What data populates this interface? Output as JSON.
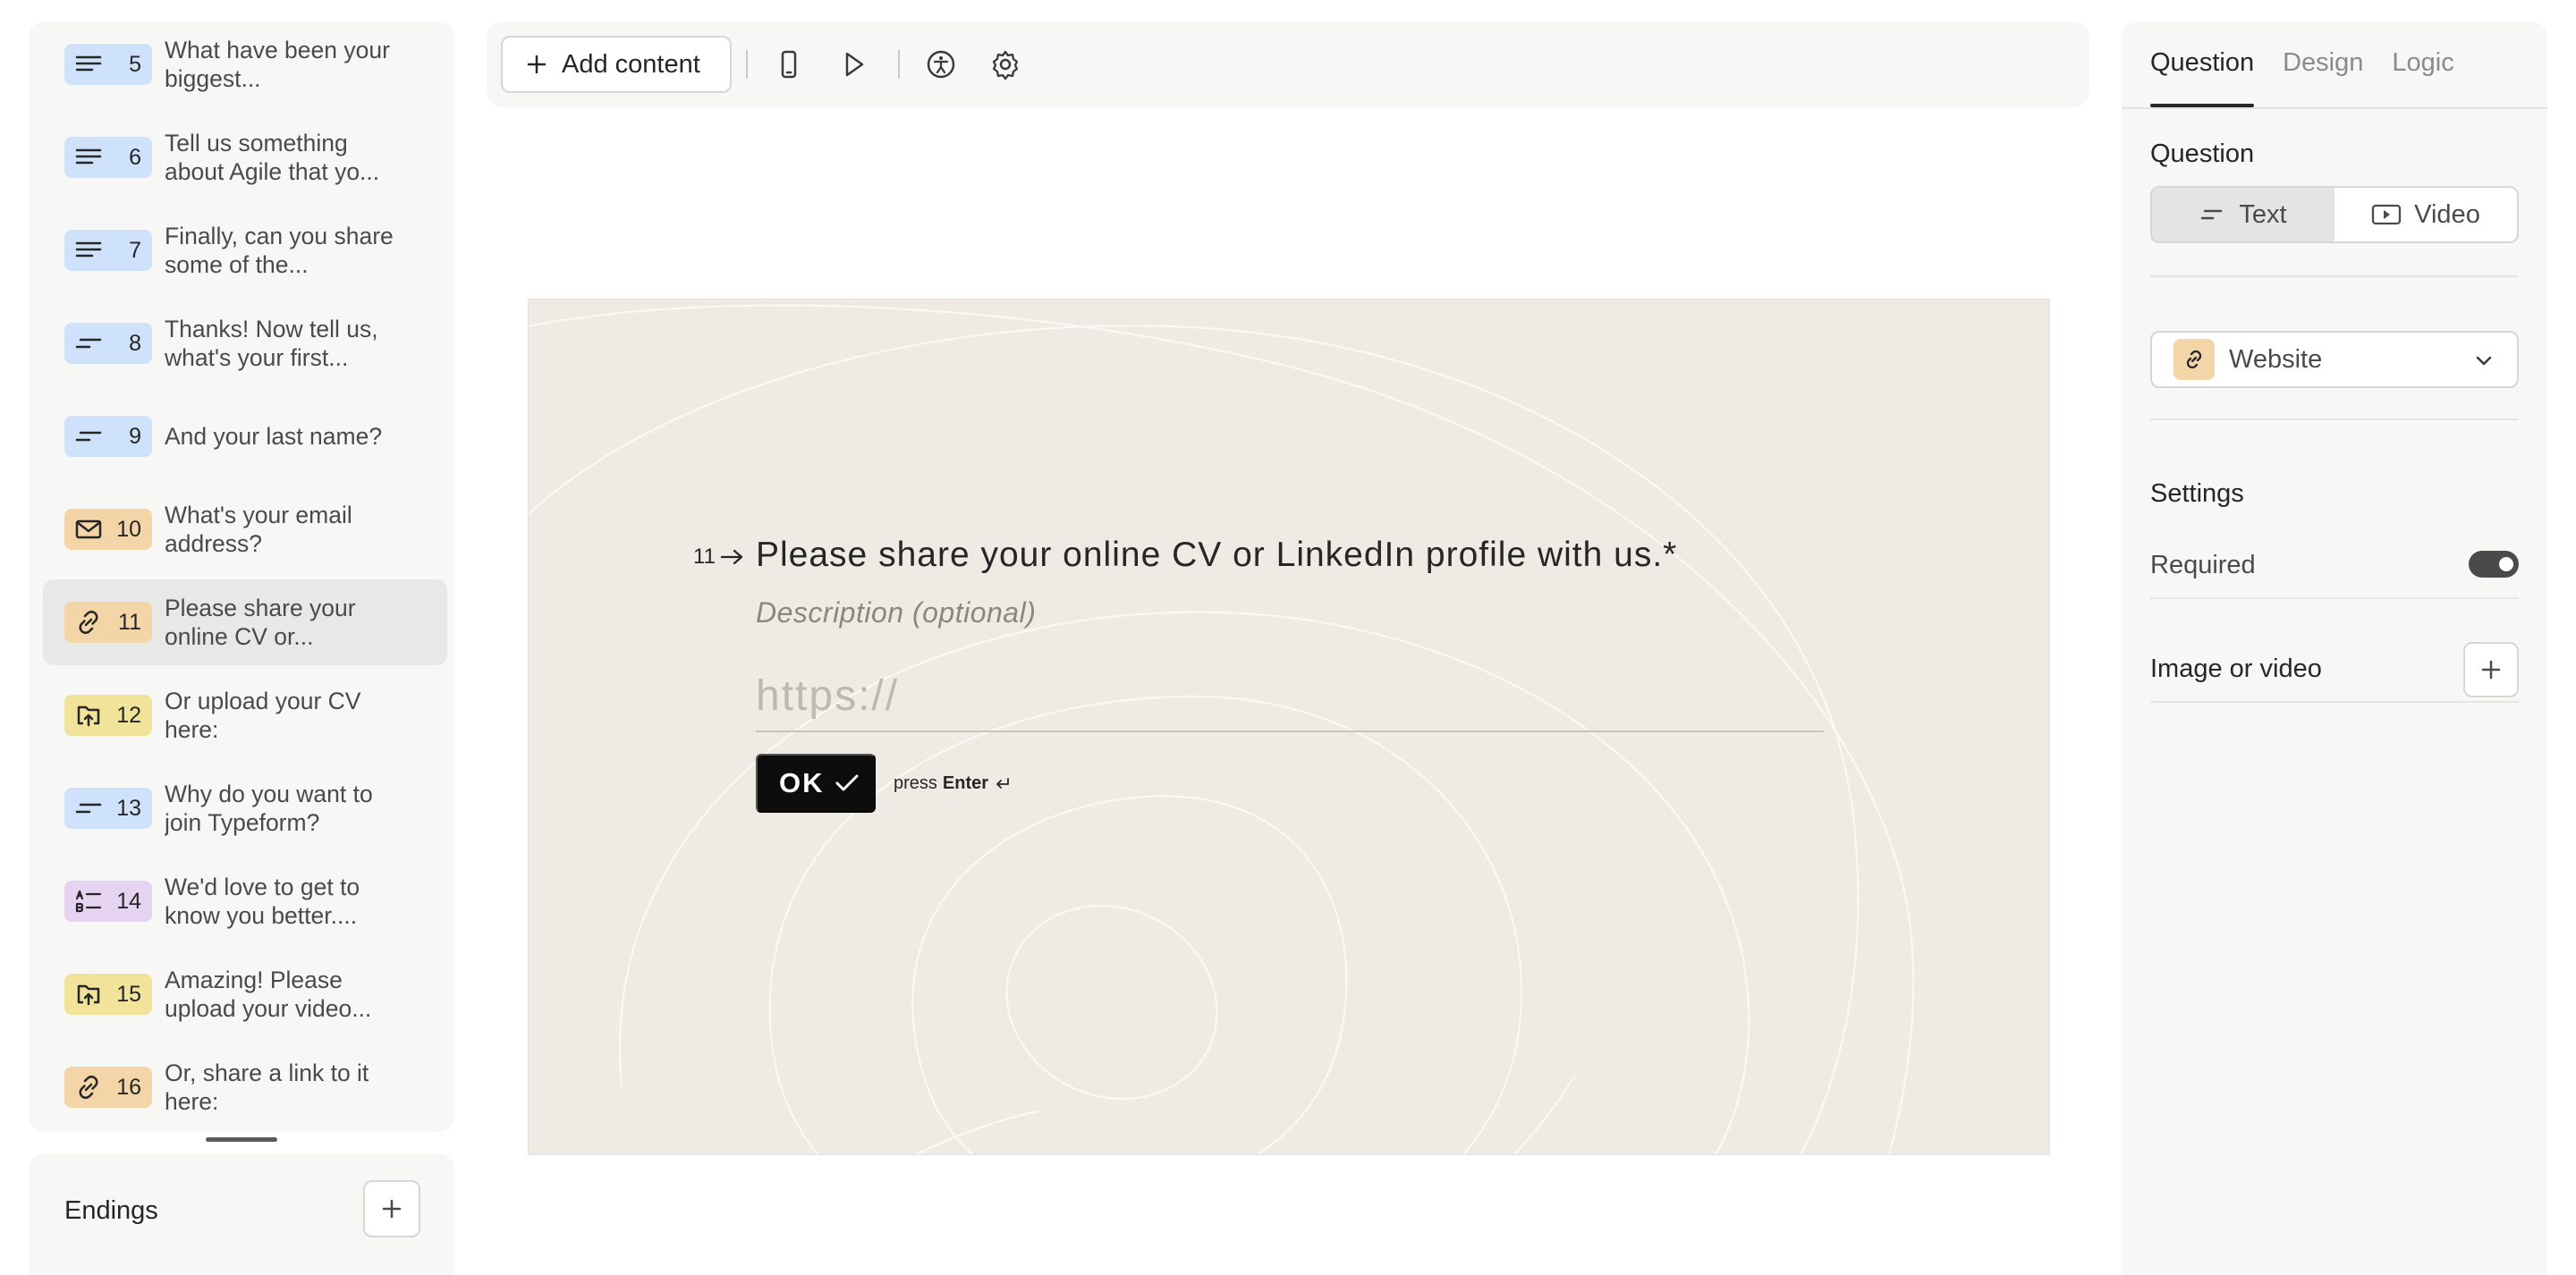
{
  "sidebar": {
    "items": [
      {
        "num": "5",
        "text": "What have been your biggest...",
        "icon": "long-text-icon",
        "color": "#cfe2fb"
      },
      {
        "num": "6",
        "text": "Tell us something about Agile that yo...",
        "icon": "long-text-icon",
        "color": "#cfe2fb"
      },
      {
        "num": "7",
        "text": "Finally, can you share some of the...",
        "icon": "long-text-icon",
        "color": "#cfe2fb"
      },
      {
        "num": "8",
        "text": "Thanks! Now tell us, what's your first...",
        "icon": "short-text-icon",
        "color": "#cfe2fb"
      },
      {
        "num": "9",
        "text": "And your last name?",
        "icon": "short-text-icon",
        "color": "#cfe2fb"
      },
      {
        "num": "10",
        "text": "What's your email address?",
        "icon": "mail-icon",
        "color": "#f3d5a8"
      },
      {
        "num": "11",
        "text": "Please share your online CV or...",
        "icon": "link-icon",
        "color": "#f3d5a8",
        "active": true
      },
      {
        "num": "12",
        "text": "Or upload your CV here:",
        "icon": "upload-icon",
        "color": "#f1e49a"
      },
      {
        "num": "13",
        "text": "Why do you want to join Typeform?",
        "icon": "short-text-icon",
        "color": "#cfe2fb"
      },
      {
        "num": "14",
        "text": "We'd love to get to know you better....",
        "icon": "multiple-choice-icon",
        "color": "#e6d3f2"
      },
      {
        "num": "15",
        "text": "Amazing! Please upload your video...",
        "icon": "upload-icon",
        "color": "#f1e49a"
      },
      {
        "num": "16",
        "text": "Or, share a link to it here:",
        "icon": "link-icon",
        "color": "#f3d5a8"
      }
    ],
    "endings_label": "Endings"
  },
  "toolbar": {
    "add_content_label": "Add content"
  },
  "canvas": {
    "question_number": "11",
    "question_title": "Please share your online CV or LinkedIn profile with us.*",
    "description_placeholder": "Description (optional)",
    "input_placeholder": "https://",
    "ok_label": "OK",
    "press_label": "press",
    "enter_label": "Enter"
  },
  "panel": {
    "tabs": [
      "Question",
      "Design",
      "Logic"
    ],
    "active_tab": "Question",
    "question_label": "Question",
    "text_option": "Text",
    "video_option": "Video",
    "type_label": "Website",
    "settings_label": "Settings",
    "required_label": "Required",
    "required_on": true,
    "media_label": "Image or video"
  }
}
